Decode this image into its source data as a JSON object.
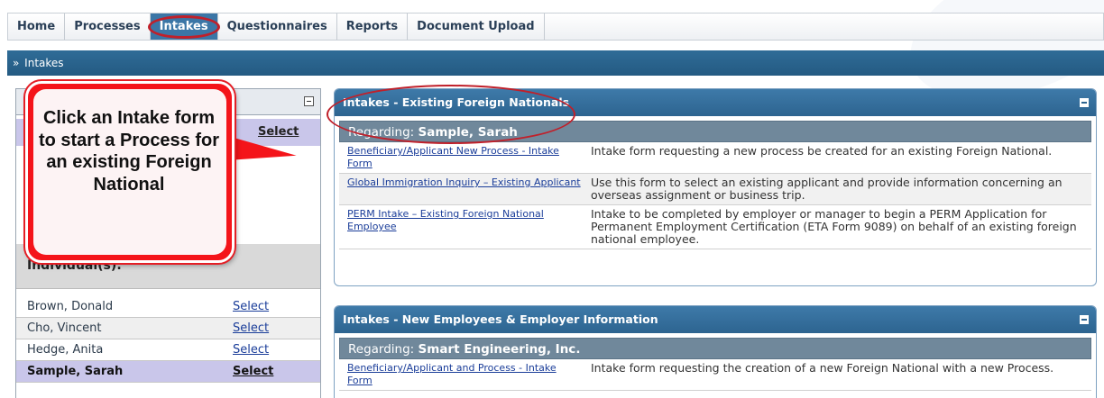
{
  "nav": {
    "tabs": [
      {
        "label": "Home"
      },
      {
        "label": "Processes"
      },
      {
        "label": "Intakes",
        "active": true
      },
      {
        "label": "Questionnaires"
      },
      {
        "label": "Reports"
      },
      {
        "label": "Document Upload"
      }
    ]
  },
  "breadcrumb": {
    "prefix": "»",
    "text": "Intakes"
  },
  "left_panel": {
    "title": "S",
    "company_select": "Select",
    "individuals_label": "Individual(s):",
    "people": [
      {
        "name": "Brown, Donald",
        "select": "Select"
      },
      {
        "name": "Cho, Vincent",
        "select": "Select"
      },
      {
        "name": "Hedge, Anita",
        "select": "Select"
      },
      {
        "name": "Sample, Sarah",
        "select": "Select",
        "current": true
      }
    ]
  },
  "callout": {
    "text": "Click an Intake form to start a Process for an existing Foreign National"
  },
  "panel1": {
    "title": "Intakes - Existing Foreign Nationals",
    "regarding_label": "Regarding:",
    "regarding_value": "Sample, Sarah",
    "rows": [
      {
        "link": "Beneficiary/Applicant New Process - Intake Form",
        "desc": "Intake form requesting a new process be created for an existing Foreign National."
      },
      {
        "link": "Global Immigration Inquiry – Existing Applicant",
        "desc": "Use this form to select an existing applicant and provide information concerning an overseas assignment or business trip."
      },
      {
        "link": "PERM Intake – Existing Foreign National Employee",
        "desc": "Intake to be completed by employer or manager to begin a PERM Application for Permanent Employment Certification (ETA Form 9089) on behalf of an existing foreign national employee."
      }
    ]
  },
  "panel2": {
    "title": "Intakes - New Employees & Employer Information",
    "regarding_label": "Regarding:",
    "regarding_value": "Smart Engineering, Inc.",
    "rows": [
      {
        "link": "Beneficiary/Applicant and Process - Intake Form",
        "desc": "Intake form requesting the creation of a new Foreign National with a new Process."
      }
    ]
  },
  "colors": {
    "tab_active": "#3b76a6",
    "header_blue": "#2d6490",
    "highlight_purple": "#c9c6ea",
    "callout_red": "#f4141a",
    "link_blue": "#1a3d99"
  }
}
